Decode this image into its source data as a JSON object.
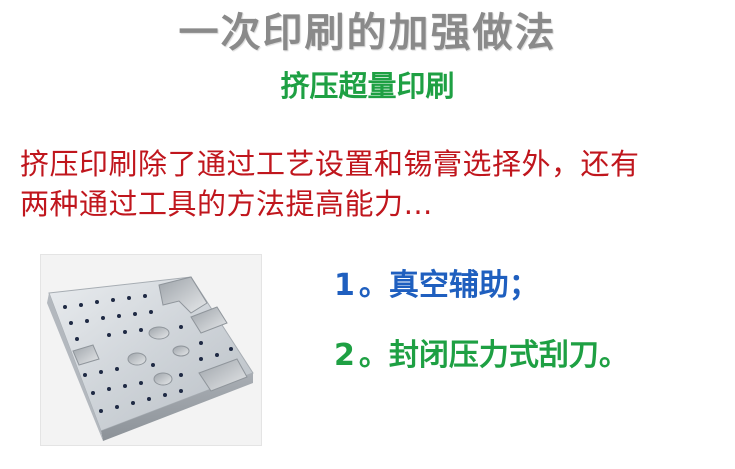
{
  "slide": {
    "title": "一次印刷的加强做法",
    "subtitle": "挤压超量印刷",
    "body_lines": [
      "挤压印刷除了通过工艺设置和锡膏选择外，还有",
      "两种通过工具的方法提高能力…"
    ],
    "methods": [
      {
        "number": "1",
        "text": "。真空辅助；"
      },
      {
        "number": "2",
        "text": "。封闭压力式刮刀。"
      }
    ],
    "colors": {
      "title": "#8a8a8a",
      "subtitle": "#1ea043",
      "body": "#c0161d",
      "method_1": "#1f5fbf",
      "method_2": "#1ea043"
    }
  }
}
